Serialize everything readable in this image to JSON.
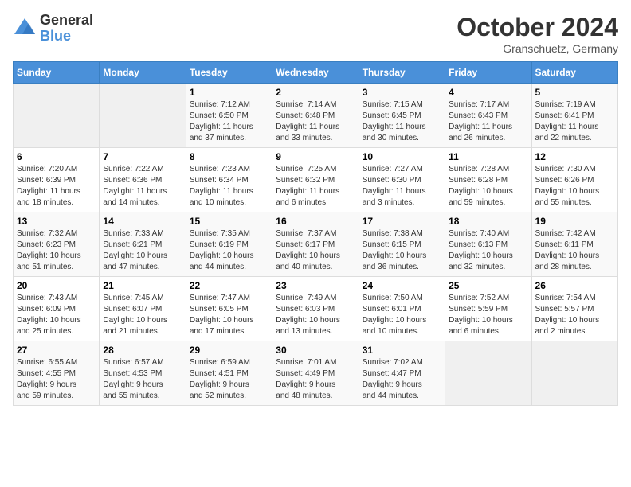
{
  "header": {
    "logo_general": "General",
    "logo_blue": "Blue",
    "month_title": "October 2024",
    "location": "Granschuetz, Germany"
  },
  "days_of_week": [
    "Sunday",
    "Monday",
    "Tuesday",
    "Wednesday",
    "Thursday",
    "Friday",
    "Saturday"
  ],
  "weeks": [
    [
      {
        "day": "",
        "info": ""
      },
      {
        "day": "",
        "info": ""
      },
      {
        "day": "1",
        "info": "Sunrise: 7:12 AM\nSunset: 6:50 PM\nDaylight: 11 hours\nand 37 minutes."
      },
      {
        "day": "2",
        "info": "Sunrise: 7:14 AM\nSunset: 6:48 PM\nDaylight: 11 hours\nand 33 minutes."
      },
      {
        "day": "3",
        "info": "Sunrise: 7:15 AM\nSunset: 6:45 PM\nDaylight: 11 hours\nand 30 minutes."
      },
      {
        "day": "4",
        "info": "Sunrise: 7:17 AM\nSunset: 6:43 PM\nDaylight: 11 hours\nand 26 minutes."
      },
      {
        "day": "5",
        "info": "Sunrise: 7:19 AM\nSunset: 6:41 PM\nDaylight: 11 hours\nand 22 minutes."
      }
    ],
    [
      {
        "day": "6",
        "info": "Sunrise: 7:20 AM\nSunset: 6:39 PM\nDaylight: 11 hours\nand 18 minutes."
      },
      {
        "day": "7",
        "info": "Sunrise: 7:22 AM\nSunset: 6:36 PM\nDaylight: 11 hours\nand 14 minutes."
      },
      {
        "day": "8",
        "info": "Sunrise: 7:23 AM\nSunset: 6:34 PM\nDaylight: 11 hours\nand 10 minutes."
      },
      {
        "day": "9",
        "info": "Sunrise: 7:25 AM\nSunset: 6:32 PM\nDaylight: 11 hours\nand 6 minutes."
      },
      {
        "day": "10",
        "info": "Sunrise: 7:27 AM\nSunset: 6:30 PM\nDaylight: 11 hours\nand 3 minutes."
      },
      {
        "day": "11",
        "info": "Sunrise: 7:28 AM\nSunset: 6:28 PM\nDaylight: 10 hours\nand 59 minutes."
      },
      {
        "day": "12",
        "info": "Sunrise: 7:30 AM\nSunset: 6:26 PM\nDaylight: 10 hours\nand 55 minutes."
      }
    ],
    [
      {
        "day": "13",
        "info": "Sunrise: 7:32 AM\nSunset: 6:23 PM\nDaylight: 10 hours\nand 51 minutes."
      },
      {
        "day": "14",
        "info": "Sunrise: 7:33 AM\nSunset: 6:21 PM\nDaylight: 10 hours\nand 47 minutes."
      },
      {
        "day": "15",
        "info": "Sunrise: 7:35 AM\nSunset: 6:19 PM\nDaylight: 10 hours\nand 44 minutes."
      },
      {
        "day": "16",
        "info": "Sunrise: 7:37 AM\nSunset: 6:17 PM\nDaylight: 10 hours\nand 40 minutes."
      },
      {
        "day": "17",
        "info": "Sunrise: 7:38 AM\nSunset: 6:15 PM\nDaylight: 10 hours\nand 36 minutes."
      },
      {
        "day": "18",
        "info": "Sunrise: 7:40 AM\nSunset: 6:13 PM\nDaylight: 10 hours\nand 32 minutes."
      },
      {
        "day": "19",
        "info": "Sunrise: 7:42 AM\nSunset: 6:11 PM\nDaylight: 10 hours\nand 28 minutes."
      }
    ],
    [
      {
        "day": "20",
        "info": "Sunrise: 7:43 AM\nSunset: 6:09 PM\nDaylight: 10 hours\nand 25 minutes."
      },
      {
        "day": "21",
        "info": "Sunrise: 7:45 AM\nSunset: 6:07 PM\nDaylight: 10 hours\nand 21 minutes."
      },
      {
        "day": "22",
        "info": "Sunrise: 7:47 AM\nSunset: 6:05 PM\nDaylight: 10 hours\nand 17 minutes."
      },
      {
        "day": "23",
        "info": "Sunrise: 7:49 AM\nSunset: 6:03 PM\nDaylight: 10 hours\nand 13 minutes."
      },
      {
        "day": "24",
        "info": "Sunrise: 7:50 AM\nSunset: 6:01 PM\nDaylight: 10 hours\nand 10 minutes."
      },
      {
        "day": "25",
        "info": "Sunrise: 7:52 AM\nSunset: 5:59 PM\nDaylight: 10 hours\nand 6 minutes."
      },
      {
        "day": "26",
        "info": "Sunrise: 7:54 AM\nSunset: 5:57 PM\nDaylight: 10 hours\nand 2 minutes."
      }
    ],
    [
      {
        "day": "27",
        "info": "Sunrise: 6:55 AM\nSunset: 4:55 PM\nDaylight: 9 hours\nand 59 minutes."
      },
      {
        "day": "28",
        "info": "Sunrise: 6:57 AM\nSunset: 4:53 PM\nDaylight: 9 hours\nand 55 minutes."
      },
      {
        "day": "29",
        "info": "Sunrise: 6:59 AM\nSunset: 4:51 PM\nDaylight: 9 hours\nand 52 minutes."
      },
      {
        "day": "30",
        "info": "Sunrise: 7:01 AM\nSunset: 4:49 PM\nDaylight: 9 hours\nand 48 minutes."
      },
      {
        "day": "31",
        "info": "Sunrise: 7:02 AM\nSunset: 4:47 PM\nDaylight: 9 hours\nand 44 minutes."
      },
      {
        "day": "",
        "info": ""
      },
      {
        "day": "",
        "info": ""
      }
    ]
  ]
}
